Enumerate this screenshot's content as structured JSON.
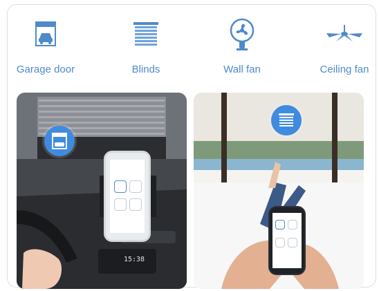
{
  "devices": [
    {
      "id": "garage",
      "label": "Garage door",
      "icon": "garage-door-icon"
    },
    {
      "id": "blinds",
      "label": "Blinds",
      "icon": "blinds-icon"
    },
    {
      "id": "wallfan",
      "label": "Wall fan",
      "icon": "wall-fan-icon"
    },
    {
      "id": "ceilingfan",
      "label": "Ceiling fan",
      "icon": "ceiling-fan-icon"
    }
  ],
  "scenes": {
    "car": {
      "badge_icon": "garage-door-icon",
      "clock": "15:38"
    },
    "bed": {
      "badge_icon": "blinds-icon"
    }
  },
  "colors": {
    "accent": "#4f8ac9",
    "badge": "#3f8be0"
  }
}
